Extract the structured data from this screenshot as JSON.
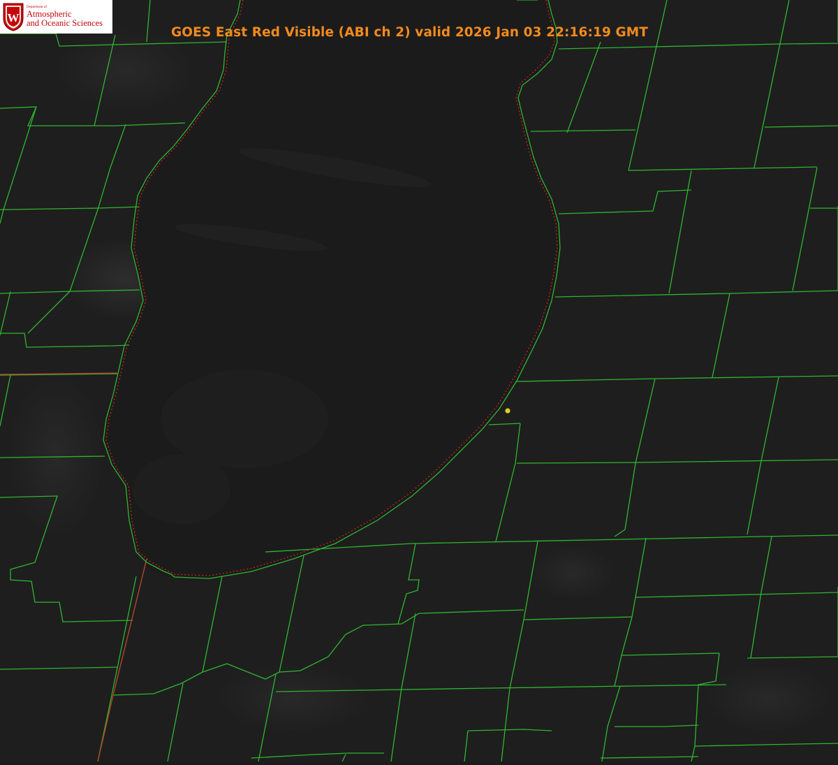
{
  "header": {
    "title": "GOES East Red Visible (ABI ch 2) valid 2026 Jan 03 22:16:19 GMT"
  },
  "logo": {
    "department_line": "Department of",
    "line1": "Atmospheric",
    "line2": "and Oceanic Sciences",
    "shield_letter": "W",
    "color": "#c5050c"
  },
  "map": {
    "background_color": "#1c1c1c",
    "lake_color": "#1a1a1a",
    "county_line_color": "#2fb52f",
    "state_line_color": "#b5452a",
    "coastline_dotted_color": "#d02020",
    "station_marker_color": "#d8d020"
  }
}
